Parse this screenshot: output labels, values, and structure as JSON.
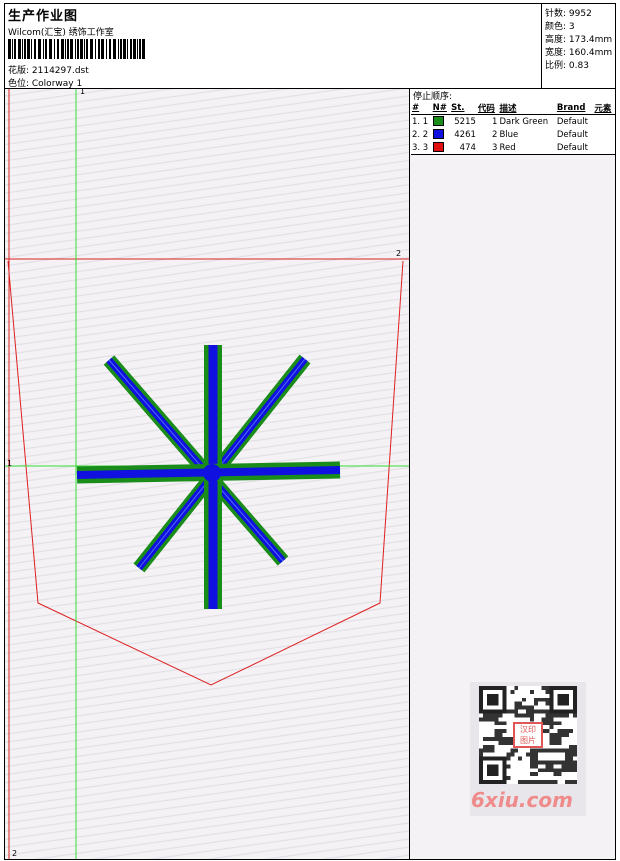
{
  "header": {
    "title": "生产作业图",
    "studio": "Wilcom(汇宝) 绣饰工作室",
    "design_file": "花版: 2114297.dst",
    "colorway": "色位: Colorway 1"
  },
  "stats": {
    "stitches": "针数: 9952",
    "colors": "颜色: 3",
    "height": "高度: 173.4mm",
    "width": "宽度: 160.4mm",
    "scale": "比例: 0.83"
  },
  "stop_sequence": {
    "title": "停止顺序:",
    "columns": [
      "#",
      "N#",
      "St.",
      "代码",
      "描述",
      "Brand",
      "元素"
    ],
    "rows": [
      {
        "idx": "1. 1",
        "stitches": "5215",
        "code": "1",
        "desc": "Dark Green",
        "brand": "Default",
        "color": "#1a8c1a"
      },
      {
        "idx": "2. 2",
        "stitches": "4261",
        "code": "2",
        "desc": "Blue",
        "brand": "Default",
        "color": "#1010e0"
      },
      {
        "idx": "3. 3",
        "stitches": "474",
        "code": "3",
        "desc": "Red",
        "brand": "Default",
        "color": "#e01010"
      }
    ]
  },
  "guides": {
    "v1": "1",
    "h1": "1",
    "h2": "2",
    "v2": "2"
  },
  "colors": {
    "guide_green": "#33dd33",
    "outline_red": "#dd2020",
    "thread_green": "#1a8c1a",
    "thread_blue": "#1010e0"
  },
  "watermark": {
    "text": "6xiu.com",
    "qr_stamp": "汉印 图片"
  }
}
